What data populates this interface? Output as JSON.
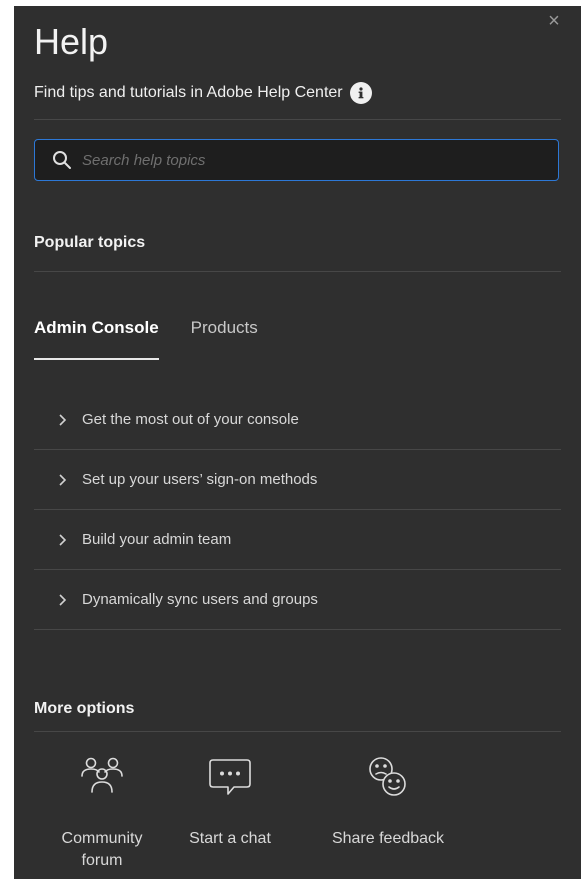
{
  "panel": {
    "title": "Help",
    "subtitle": "Find tips and tutorials in Adobe Help Center",
    "close_glyph": "×"
  },
  "search": {
    "placeholder": "Search help topics",
    "value": ""
  },
  "popular_topics": {
    "heading": "Popular topics",
    "tabs": [
      {
        "label": "Admin Console",
        "active": true
      },
      {
        "label": "Products",
        "active": false
      }
    ],
    "items": [
      {
        "label": "Get the most out of your console"
      },
      {
        "label": "Set up your users’ sign-on methods"
      },
      {
        "label": "Build your admin team"
      },
      {
        "label": "Dynamically sync users and groups"
      }
    ]
  },
  "more_options": {
    "heading": "More options",
    "items": [
      {
        "label_line1": "Community",
        "label_line2": "forum",
        "icon": "community-icon"
      },
      {
        "label_line1": "Start a chat",
        "label_line2": "",
        "icon": "chat-icon"
      },
      {
        "label_line1": "Share feedback",
        "label_line2": "",
        "icon": "feedback-icon"
      }
    ]
  },
  "colors": {
    "panel_bg": "#2f2f2f",
    "search_border": "#2d78d6",
    "divider": "#474747",
    "text": "#e8e8e8"
  }
}
